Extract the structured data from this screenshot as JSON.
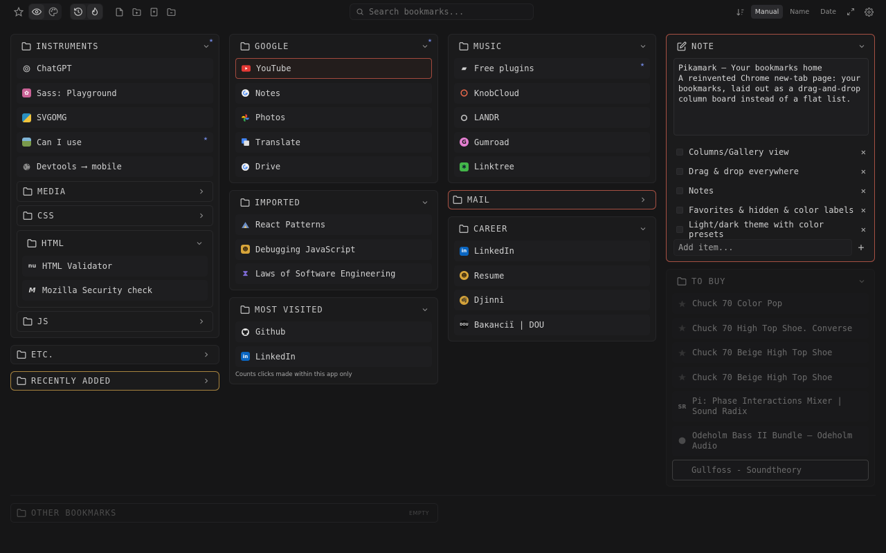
{
  "search": {
    "placeholder": "Search bookmarks..."
  },
  "sort": {
    "manual": "Manual",
    "name": "Name",
    "date": "Date"
  },
  "instruments": {
    "title": "INSTRUMENTS",
    "items": [
      {
        "label": "ChatGPT"
      },
      {
        "label": "Sass: Playground"
      },
      {
        "label": "SVGOMG"
      },
      {
        "label": "Can I use"
      },
      {
        "label": "Devtools ⟶ mobile"
      }
    ],
    "folders": {
      "media": "MEDIA",
      "css": "CSS",
      "html": "HTML",
      "js": "JS"
    },
    "html_items": [
      {
        "label": "HTML Validator"
      },
      {
        "label": "Mozilla Security check"
      }
    ]
  },
  "etc": {
    "title": "ETC."
  },
  "recent": {
    "title": "RECENTLY ADDED"
  },
  "google": {
    "title": "GOOGLE",
    "items": [
      {
        "label": "YouTube"
      },
      {
        "label": "Notes"
      },
      {
        "label": "Photos"
      },
      {
        "label": "Translate"
      },
      {
        "label": "Drive"
      }
    ]
  },
  "imported": {
    "title": "IMPORTED",
    "items": [
      {
        "label": "React Patterns"
      },
      {
        "label": "Debugging JavaScript"
      },
      {
        "label": "Laws of Software Engineering"
      }
    ]
  },
  "most_visited": {
    "title": "MOST VISITED",
    "items": [
      {
        "label": "Github"
      },
      {
        "label": "LinkedIn"
      }
    ],
    "footnote": "Counts clicks made within this app only"
  },
  "music": {
    "title": "MUSIC",
    "items": [
      {
        "label": "Free plugins"
      },
      {
        "label": "KnobCloud"
      },
      {
        "label": "LANDR"
      },
      {
        "label": "Gumroad"
      },
      {
        "label": "Linktree"
      }
    ]
  },
  "mail": {
    "title": "MAIL"
  },
  "career": {
    "title": "CAREER",
    "items": [
      {
        "label": "LinkedIn"
      },
      {
        "label": "Resume"
      },
      {
        "label": "Djinni"
      },
      {
        "label": "Вакансії | DOU"
      }
    ]
  },
  "note": {
    "title": "NOTE",
    "text": "Pikamark — Your bookmarks home\nA reinvented Chrome new-tab page: your bookmarks, laid out as a drag-and-drop column board instead of a flat list.",
    "checklist": [
      {
        "label": "Columns/Gallery view"
      },
      {
        "label": "Drag & drop everywhere"
      },
      {
        "label": "Notes"
      },
      {
        "label": "Favorites & hidden & color labels"
      },
      {
        "label": "Light/dark theme with color presets"
      }
    ],
    "add_placeholder": "Add item..."
  },
  "to_buy": {
    "title": "TO BUY",
    "items": [
      {
        "label": "Chuck 70 Color Pop"
      },
      {
        "label": "Chuck 70 High Top Shoe. Converse"
      },
      {
        "label": "Chuck 70 Beige High Top Shoe"
      },
      {
        "label": "Chuck 70 Beige High Top Shoe"
      },
      {
        "label": "Pi: Phase Interactions Mixer | Sound Radix"
      },
      {
        "label": "Odeholm Bass II Bundle – Odeholm Audio"
      },
      {
        "label": "Gullfoss - Soundtheory"
      }
    ]
  },
  "other": {
    "title": "OTHER BOOKMARKS",
    "empty": "EMPTY"
  },
  "favicons": {
    "chatgpt": {
      "text": "◎",
      "color": "#3a3a3a"
    },
    "sass": {
      "color": "#c96195"
    },
    "svgomg": {
      "color": "#2a8fbf"
    },
    "caniuse": {
      "color": "#9a6f3c"
    },
    "google": {
      "color": "#e8453c"
    },
    "linkedin": {
      "text": "in",
      "color": "#0a66c2"
    },
    "gumroad": {
      "text": "G",
      "color": "#e47fd1"
    },
    "linktree": {
      "text": "✱",
      "color": "#43b649"
    },
    "djinni": {
      "text": "dj",
      "color": "#d2a13a"
    },
    "dou": {
      "text": "DOU",
      "color": "#333333"
    }
  }
}
